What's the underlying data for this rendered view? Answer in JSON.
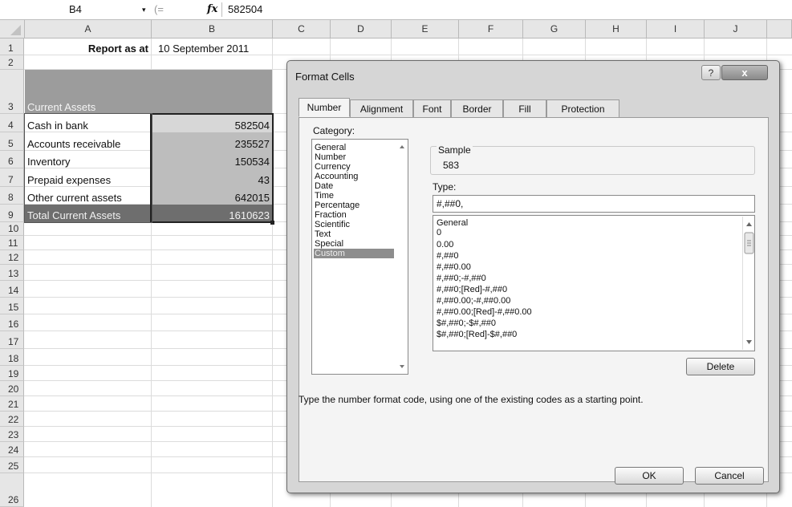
{
  "formula_bar": {
    "name_box": "B4",
    "name_box_arrow": "▾",
    "separator": "(=",
    "fx_label": "fx",
    "value": "582504"
  },
  "columns": [
    "A",
    "B",
    "C",
    "D",
    "E",
    "F",
    "G",
    "H",
    "I",
    "J"
  ],
  "rows": [
    "1",
    "2",
    "3",
    "4",
    "5",
    "6",
    "7",
    "8",
    "9",
    "10",
    "11",
    "12",
    "13",
    "14",
    "15",
    "16",
    "17",
    "18",
    "19",
    "20",
    "21",
    "22",
    "23",
    "24",
    "25",
    "26"
  ],
  "cells": {
    "A1": "Report as at",
    "B1": "10 September 2011",
    "A3": "Current Assets",
    "A4": "Cash in bank",
    "B4": "582504",
    "A5": "Accounts receivable",
    "B5": "235527",
    "A6": "Inventory",
    "B6": "150534",
    "A7": "Prepaid expenses",
    "B7": "43",
    "A8": "Other current assets",
    "B8": "642015",
    "A9": "Total Current Assets",
    "B9": "1610623"
  },
  "dialog": {
    "title": "Format Cells",
    "help_label": "?",
    "close_label": "x",
    "tabs": [
      "Number",
      "Alignment",
      "Font",
      "Border",
      "Fill",
      "Protection"
    ],
    "active_tab": "Number",
    "category_label": "Category:",
    "categories": [
      "General",
      "Number",
      "Currency",
      "Accounting",
      "Date",
      "Time",
      "Percentage",
      "Fraction",
      "Scientific",
      "Text",
      "Special",
      "Custom"
    ],
    "selected_category": "Custom",
    "sample_label": "Sample",
    "sample_value": "583",
    "type_label": "Type:",
    "type_value": "#,##0,",
    "type_list": [
      "General",
      "0",
      "0.00",
      "#,##0",
      "#,##0.00",
      "#,##0;-#,##0",
      "#,##0;[Red]-#,##0",
      "#,##0.00;-#,##0.00",
      "#,##0.00;[Red]-#,##0.00",
      "$#,##0;-$#,##0",
      "$#,##0;[Red]-$#,##0"
    ],
    "delete_label": "Delete",
    "hint": "Type the number format code, using one of the existing codes as a starting point.",
    "ok_label": "OK",
    "cancel_label": "Cancel"
  },
  "colors": {
    "header_shade": "#9c9c9c",
    "total_row": "#6e6e6e",
    "value_shade": "#bdbdbd",
    "selected_category": "#8d8d8d"
  }
}
